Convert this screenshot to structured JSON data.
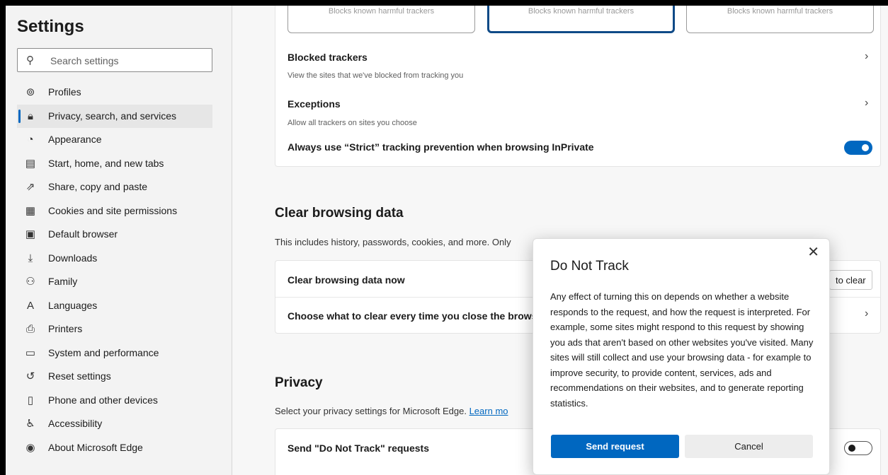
{
  "sidebar": {
    "title": "Settings",
    "search_placeholder": "Search settings",
    "items": [
      {
        "label": "Profiles",
        "icon": "profile-icon",
        "glyph": "⊚"
      },
      {
        "label": "Privacy, search, and services",
        "icon": "lock-icon",
        "glyph": "🔒︎",
        "active": true
      },
      {
        "label": "Appearance",
        "icon": "palette-icon",
        "glyph": "◔"
      },
      {
        "label": "Start, home, and new tabs",
        "icon": "home-tabs-icon",
        "glyph": "▤"
      },
      {
        "label": "Share, copy and paste",
        "icon": "share-icon",
        "glyph": "⇗"
      },
      {
        "label": "Cookies and site permissions",
        "icon": "cookies-icon",
        "glyph": "▦"
      },
      {
        "label": "Default browser",
        "icon": "browser-icon",
        "glyph": "▣"
      },
      {
        "label": "Downloads",
        "icon": "download-icon",
        "glyph": "⤓"
      },
      {
        "label": "Family",
        "icon": "family-icon",
        "glyph": "⚇"
      },
      {
        "label": "Languages",
        "icon": "languages-icon",
        "glyph": "A"
      },
      {
        "label": "Printers",
        "icon": "printer-icon",
        "glyph": "⎙"
      },
      {
        "label": "System and performance",
        "icon": "system-icon",
        "glyph": "▭"
      },
      {
        "label": "Reset settings",
        "icon": "reset-icon",
        "glyph": "↺"
      },
      {
        "label": "Phone and other devices",
        "icon": "phone-icon",
        "glyph": "▯"
      },
      {
        "label": "Accessibility",
        "icon": "accessibility-icon",
        "glyph": "♿︎"
      },
      {
        "label": "About Microsoft Edge",
        "icon": "edge-logo-icon",
        "glyph": "◉"
      }
    ]
  },
  "tracking": {
    "tile_text": "Blocks known harmful trackers",
    "blocked_title": "Blocked trackers",
    "blocked_sub": "View the sites that we've blocked from tracking you",
    "exceptions_title": "Exceptions",
    "exceptions_sub": "Allow all trackers on sites you choose",
    "strict_label": "Always use “Strict” tracking prevention when browsing InPrivate",
    "strict_on": true
  },
  "clear": {
    "heading": "Clear browsing data",
    "desc": "This includes history, passwords, cookies, and more. Only",
    "now_label": "Clear browsing data now",
    "choose_btn": "to clear",
    "close_label": "Choose what to clear every time you close the brows"
  },
  "privacy": {
    "heading": "Privacy",
    "desc": "Select your privacy settings for Microsoft Edge.",
    "learn_more": "Learn mo",
    "dnt_label": "Send \"Do Not Track\" requests",
    "dnt_on": false
  },
  "dialog": {
    "title": "Do Not Track",
    "close_glyph": "✕",
    "body": "Any effect of turning this on depends on whether a website responds to the request, and how the request is interpreted. For example, some sites might respond to this request by showing you ads that aren't based on other websites you've visited. Many sites will still collect and use your browsing data - for example to improve security, to provide content, services, ads and recommendations on their websites, and to generate reporting statistics.",
    "primary": "Send request",
    "secondary": "Cancel"
  },
  "colors": {
    "accent": "#0067c0"
  }
}
